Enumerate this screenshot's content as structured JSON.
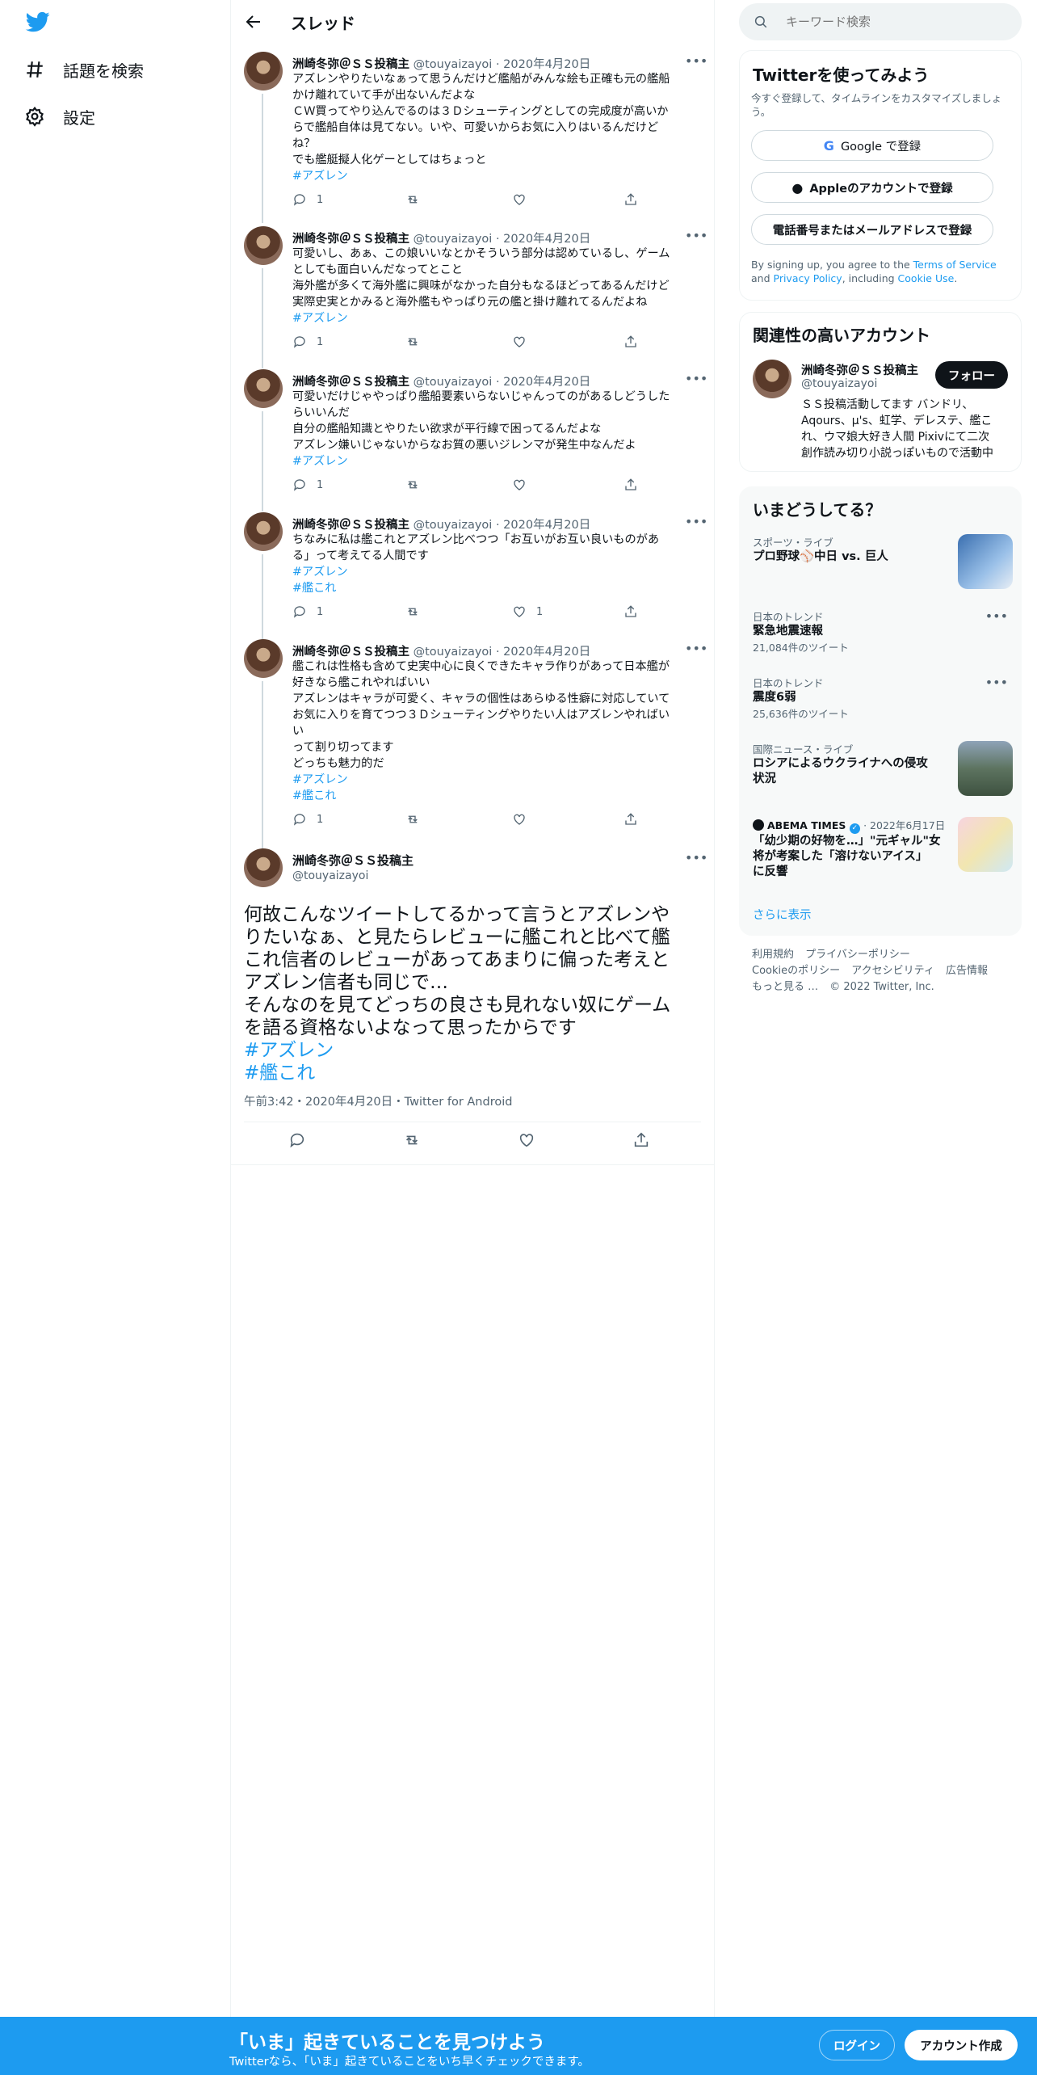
{
  "nav": {
    "explore_label": "話題を検索",
    "settings_label": "設定"
  },
  "header": {
    "title": "スレッド"
  },
  "tweets": [
    {
      "name": "洲崎冬弥＠ＳＳ投稿主",
      "handle": "@touyaizayoi",
      "date": "2020年4月20日",
      "lines": [
        "アズレンやりたいなぁって思うんだけど艦船がみんな絵も正確も元の艦船",
        "かけ離れていて手が出ないんだよな",
        "ＣＷ買ってやり込んでるのは３Ｄシューティングとしての完成度が高いか",
        "らで艦船自体は見てない。いや、可愛いからお気に入りはいるんだけど",
        "ね？",
        "でも艦艇擬人化ゲーとしてはちょっと"
      ],
      "tags": [
        "#アズレン"
      ],
      "replies": "1",
      "likes": ""
    },
    {
      "name": "洲崎冬弥＠ＳＳ投稿主",
      "handle": "@touyaizayoi",
      "date": "2020年4月20日",
      "lines": [
        "可愛いし、あぁ、この娘いいなとかそういう部分は認めているし、ゲーム",
        "としても面白いんだなってとこと",
        "海外艦が多くて海外艦に興味がなかった自分もなるほどってあるんだけど",
        "実際史実とかみると海外艦もやっぱり元の艦と掛け離れてるんだよね"
      ],
      "tags": [
        "#アズレン"
      ],
      "replies": "1",
      "likes": ""
    },
    {
      "name": "洲崎冬弥＠ＳＳ投稿主",
      "handle": "@touyaizayoi",
      "date": "2020年4月20日",
      "lines": [
        "可愛いだけじゃやっぱり艦船要素いらないじゃんってのがあるしどうした",
        "らいいんだ",
        "自分の艦船知識とやりたい欲求が平行線で困ってるんだよな",
        "アズレン嫌いじゃないからなお質の悪いジレンマが発生中なんだよ"
      ],
      "tags": [
        "#アズレン"
      ],
      "replies": "1",
      "likes": ""
    },
    {
      "name": "洲崎冬弥＠ＳＳ投稿主",
      "handle": "@touyaizayoi",
      "date": "2020年4月20日",
      "lines": [
        "ちなみに私は艦これとアズレン比べつつ「お互いがお互い良いものがあ",
        "る」って考えてる人間です"
      ],
      "tags": [
        "#アズレン",
        "#艦これ"
      ],
      "replies": "1",
      "likes": "1"
    },
    {
      "name": "洲崎冬弥＠ＳＳ投稿主",
      "handle": "@touyaizayoi",
      "date": "2020年4月20日",
      "lines": [
        "艦これは性格も含めて史実中心に良くできたキャラ作りがあって日本艦が",
        "好きなら艦これやればいい",
        "アズレンはキャラが可愛く、キャラの個性はあらゆる性癖に対応していて",
        "お気に入りを育てつつ３Ｄシューティングやりたい人はアズレンやればい",
        "い",
        "って割り切ってます",
        "どっちも魅力的だ"
      ],
      "tags": [
        "#アズレン",
        "#艦これ"
      ],
      "replies": "1",
      "likes": ""
    }
  ],
  "focus": {
    "name": "洲崎冬弥＠ＳＳ投稿主",
    "handle": "@touyaizayoi",
    "lines": [
      "何故こんなツイートしてるかって言うとアズレンや",
      "りたいなぁ、と見たらレビューに艦これと比べて艦",
      "これ信者のレビューがあってあまりに偏った考えと",
      "アズレン信者も同じで…",
      "そんなのを見てどっちの良さも見れない奴にゲーム",
      "を語る資格ないよなって思ったからです"
    ],
    "tags": [
      "#アズレン",
      "#艦これ"
    ],
    "timestamp": "午前3:42・2020年4月20日・Twitter for Android"
  },
  "search": {
    "placeholder": "キーワード検索"
  },
  "signup_card": {
    "title": "Twitterを使ってみよう",
    "subtitle": "今すぐ登録して、タイムラインをカスタマイズしましょう。",
    "google_label": "Google で登録",
    "apple_label": "Appleのアカウントで登録",
    "phone_label": "電話番号またはメールアドレスで登録",
    "terms_prefix": "By signing up, you agree to the ",
    "terms_link": "Terms of Service",
    "terms_and": " and ",
    "privacy_link": "Privacy Policy",
    "terms_including": ", including ",
    "cookie_link": "Cookie Use",
    "terms_end": "."
  },
  "related": {
    "title": "関連性の高いアカウント",
    "name": "洲崎冬弥＠ＳＳ投稿主",
    "handle": "@touyaizayoi",
    "follow_label": "フォロー",
    "bio_lines": [
      "ＳＳ投稿活動してます バンドリ、",
      "Aqours、μ's、虹学、デレステ、艦こ",
      "れ、ウマ娘大好き人間 Pixivにて二次",
      "創作読み切り小説っぽいもので活動中"
    ]
  },
  "trends": {
    "title": "いまどうしてる？",
    "items": [
      {
        "category": "スポーツ・ライブ",
        "title": "プロ野球⚾中日 vs. 巨人",
        "sub": ""
      },
      {
        "category": "日本のトレンド",
        "title": "緊急地震速報",
        "sub": "21,084件のツイート"
      },
      {
        "category": "日本のトレンド",
        "title": "震度6弱",
        "sub": "25,636件のツイート"
      },
      {
        "category": "国際ニュース・ライブ",
        "title": "ロシアによるウクライナへの侵攻\n状況",
        "sub": ""
      },
      {
        "category": "ABEMA TIMES",
        "category_date": "2022年6月17日",
        "title": "「幼少期の好物を…」\"元ギャル\"女\n将が考案した「溶けないアイス」\nに反響",
        "sub": ""
      }
    ],
    "show_more": "さらに表示"
  },
  "footer": {
    "terms": "利用規約",
    "privacy": "プライバシーポリシー",
    "cookie": "Cookieのポリシー",
    "accessibility": "アクセシビリティ",
    "ads": "広告情報",
    "more": "もっと見る …",
    "copyright": "© 2022 Twitter, Inc."
  },
  "banner": {
    "headline": "「いま」起きていることを見つけよう",
    "subline": "Twitterなら、「いま」起きていることをいち早くチェックできます。",
    "login_label": "ログイン",
    "signup_label": "アカウント作成"
  },
  "colors": {
    "accent": "#1d9bf0",
    "text": "#0f1419",
    "muted": "#536471"
  }
}
